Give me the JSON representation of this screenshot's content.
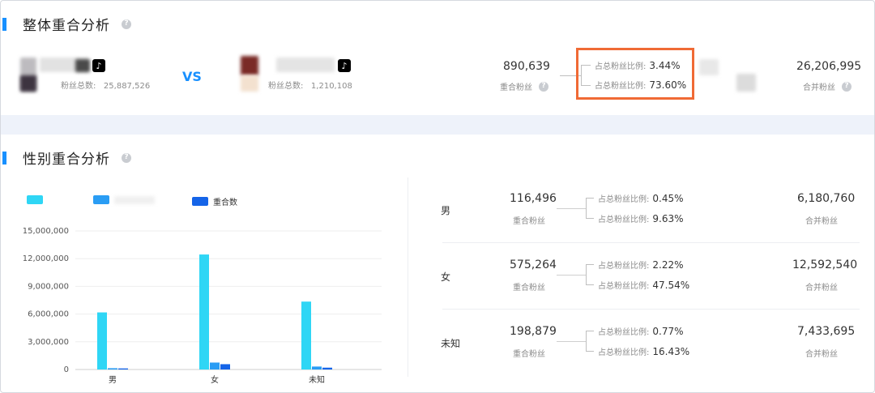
{
  "overall": {
    "title": "整体重合分析",
    "help": "?",
    "account_a": {
      "fans_label": "粉丝总数:",
      "fans_value": "25,887,526"
    },
    "vs": "VS",
    "account_b": {
      "fans_label": "粉丝总数:",
      "fans_value": "1,210,108"
    },
    "overlap_value": "890,639",
    "overlap_label": "重合粉丝",
    "ratio_label": "占总粉丝比例:",
    "ratio_a": "3.44%",
    "ratio_b": "73.60%",
    "merged_value": "26,206,995",
    "merged_label": "合并粉丝"
  },
  "gender": {
    "title": "性别重合分析",
    "help": "?",
    "legend": [
      {
        "label": "",
        "color": "#2fd6f5"
      },
      {
        "label": "",
        "color": "#2a9df4"
      },
      {
        "label": "重合数",
        "color": "#1564e8"
      }
    ],
    "rows": [
      {
        "category": "男",
        "overlap": "116,496",
        "overlap_label": "重合粉丝",
        "ratio_label": "占总粉丝比例:",
        "ratio_a": "0.45%",
        "ratio_b": "9.63%",
        "merged": "6,180,760",
        "merged_label": "合并粉丝"
      },
      {
        "category": "女",
        "overlap": "575,264",
        "overlap_label": "重合粉丝",
        "ratio_label": "占总粉丝比例:",
        "ratio_a": "2.22%",
        "ratio_b": "47.54%",
        "merged": "12,592,540",
        "merged_label": "合并粉丝"
      },
      {
        "category": "未知",
        "overlap": "198,879",
        "overlap_label": "重合粉丝",
        "ratio_label": "占总粉丝比例:",
        "ratio_a": "0.77%",
        "ratio_b": "16.43%",
        "merged": "7,433,695",
        "merged_label": "合并粉丝"
      }
    ]
  },
  "chart_data": {
    "type": "bar",
    "categories": [
      "男",
      "女",
      "未知"
    ],
    "ylim": [
      0,
      15000000
    ],
    "yticks": [
      "0",
      "3,000,000",
      "6,000,000",
      "9,000,000",
      "12,000,000",
      "15,000,000"
    ],
    "series": [
      {
        "values": [
          6180000,
          12450000,
          7350000
        ]
      },
      {
        "values": [
          140000,
          750000,
          320000
        ]
      },
      {
        "name": "重合数",
        "values": [
          116496,
          575264,
          198879
        ]
      }
    ],
    "grid": true,
    "legend_position": "top-left"
  }
}
